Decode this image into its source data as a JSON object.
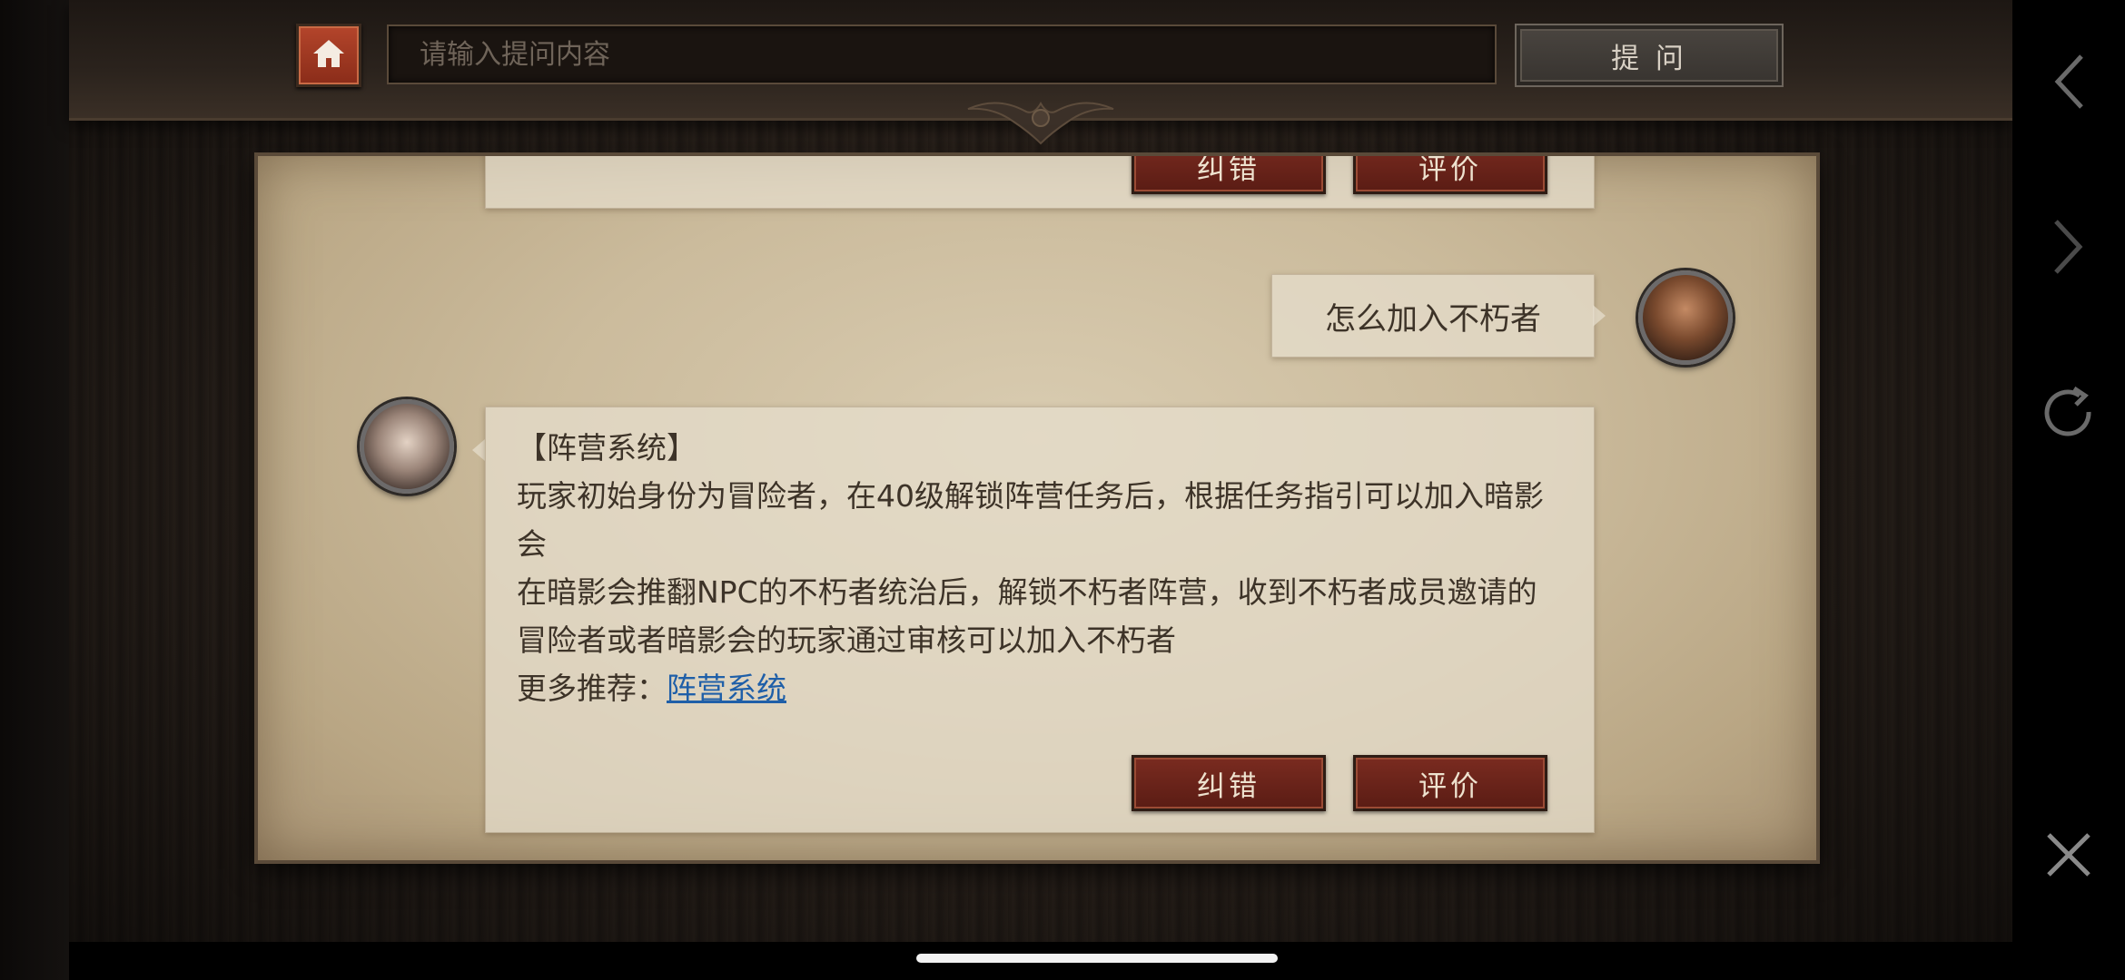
{
  "search": {
    "placeholder": "请输入提问内容",
    "value": ""
  },
  "toolbar": {
    "ask_label": "提 问"
  },
  "chat": {
    "previous_answer_buttons": {
      "correct_label": "纠错",
      "rate_label": "评价"
    },
    "user_question": "怎么加入不朽者",
    "answer": {
      "title": "【阵营系统】",
      "paragraph_1": "玩家初始身份为冒险者，在40级解锁阵营任务后，根据任务指引可以加入暗影会",
      "paragraph_2": "在暗影会推翻NPC的不朽者统治后，解锁不朽者阵营，收到不朽者成员邀请的冒险者或者暗影会的玩家通过审核可以加入不朽者",
      "more_prefix": "更多推荐：",
      "more_link": "阵营系统",
      "correct_label": "纠错",
      "rate_label": "评价"
    }
  },
  "icons": {
    "home": "home-icon",
    "back": "chevron-left-icon",
    "forward": "chevron-right-icon",
    "refresh": "refresh-icon",
    "close": "close-icon"
  },
  "colors": {
    "accent_red": "#7a2b20",
    "link_blue": "#1f5fa8",
    "parchment": "#cbbb9c"
  }
}
